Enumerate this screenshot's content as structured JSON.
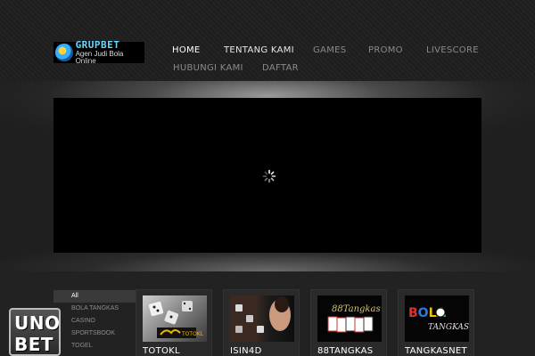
{
  "header": {
    "logo": {
      "brand": "GRUPBET",
      "tagline": "Agen Judi Bola Online"
    },
    "nav": [
      {
        "label": "HOME"
      },
      {
        "label": "TENTANG KAMI"
      },
      {
        "label": "GAMES"
      },
      {
        "label": "PROMO"
      },
      {
        "label": "LIVESCORE"
      },
      {
        "label": "HUBUNGI KAMI"
      },
      {
        "label": "DAFTAR"
      }
    ]
  },
  "slider": {
    "loading_icon": "spinner-icon"
  },
  "portfolio": {
    "filters": [
      {
        "label": "All"
      },
      {
        "label": "BOLA TANGKAS"
      },
      {
        "label": "CASINO"
      },
      {
        "label": "SPORTSBOOK"
      },
      {
        "label": "TOGEL"
      }
    ],
    "cards": [
      {
        "title": "TOTOKL",
        "thumb_text": "TOTOKL"
      },
      {
        "title": "ISIN4D",
        "thumb_text": ""
      },
      {
        "title": "88TANGKAS",
        "thumb_text": "88Tangkas"
      },
      {
        "title": "TANGKASNET",
        "thumb_text": "BOLA TANGKAS"
      }
    ]
  },
  "badge": {
    "line1": "UNO",
    "line2": "BET"
  },
  "colors": {
    "accent": "#6bd6ff",
    "background": "#1c1c1c",
    "slider": "#000000"
  }
}
